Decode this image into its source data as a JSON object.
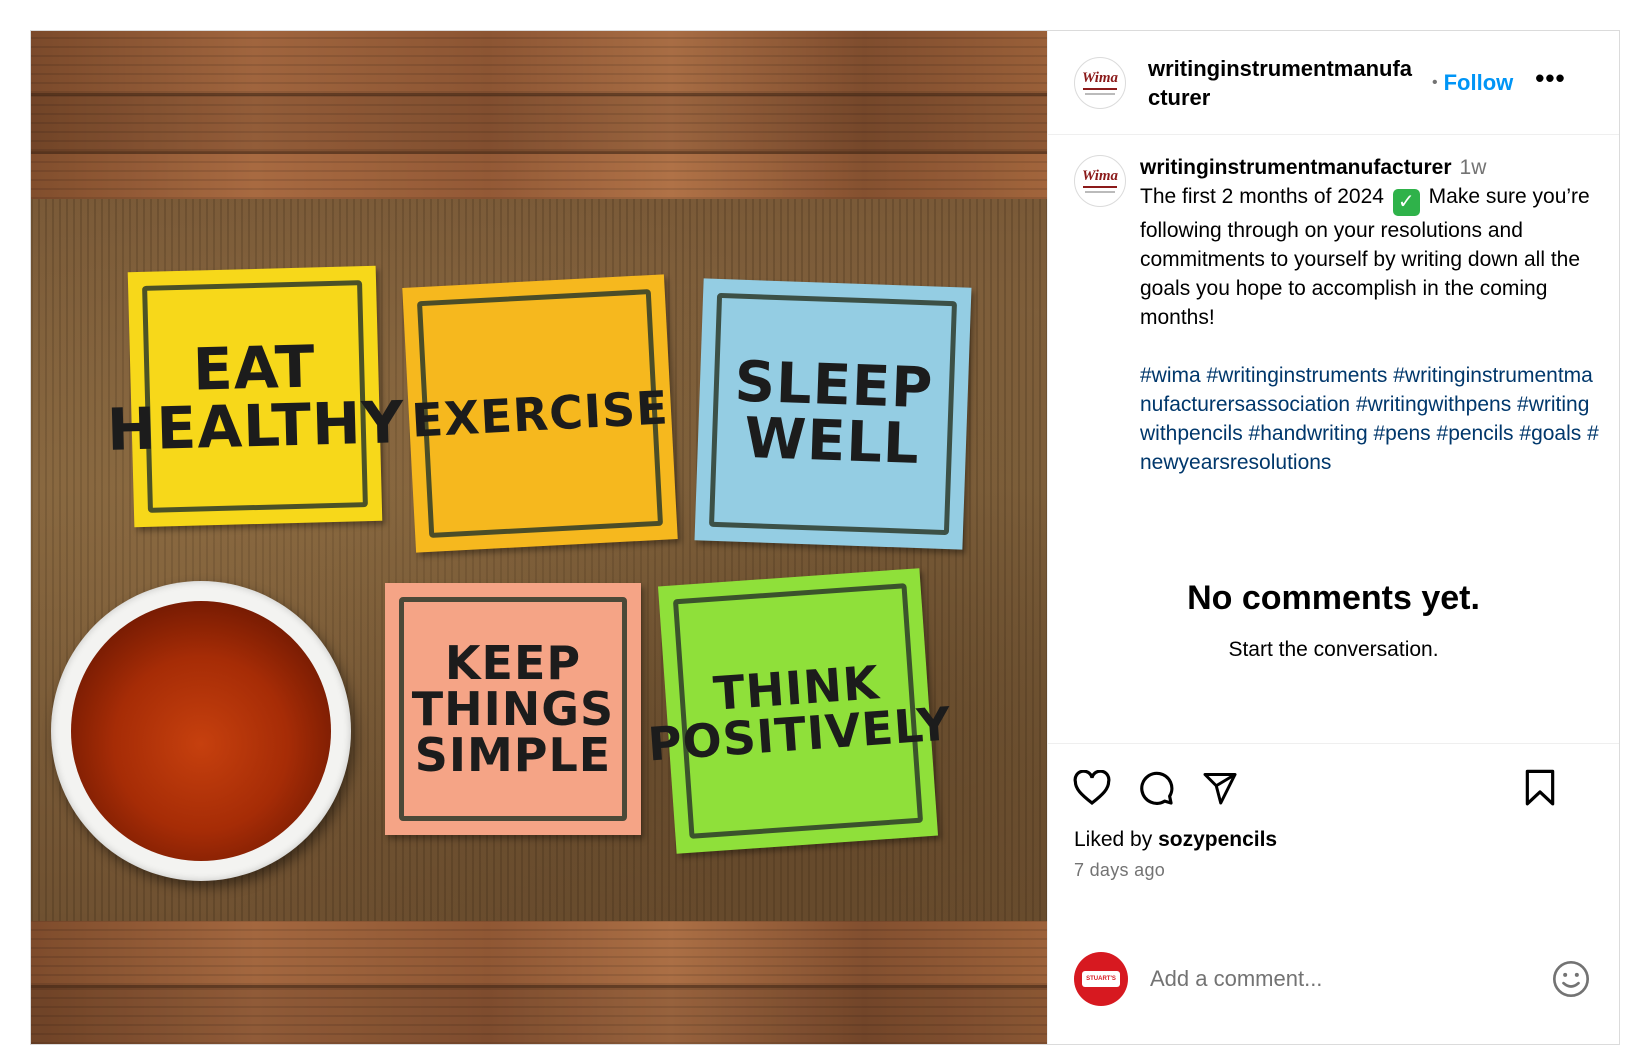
{
  "post": {
    "image_alt": "Sticky notes on wooden table with a cup of tea",
    "notes": [
      {
        "text": "EAT\nHEALTHY",
        "color": "#f7d81a"
      },
      {
        "text": "EXERCISE",
        "color": "#f6b81e"
      },
      {
        "text": "SLEEP\nWELL",
        "color": "#94cde3"
      },
      {
        "text": "KEEP\nTHINGS\nSIMPLE",
        "color": "#f5a486"
      },
      {
        "text": "THINK\nPOSITIVELY",
        "color": "#8fe03a"
      }
    ]
  },
  "header": {
    "username": "writinginstrumentmanufacturer",
    "separator": "•",
    "follow_label": "Follow",
    "more_label": "•••",
    "avatar_logo": "Wima"
  },
  "caption": {
    "username": "writinginstrumentmanufacturer",
    "time": "1w",
    "text_before_check": "The first 2 months of 2024",
    "check_glyph": "✓",
    "text_after_check": "Make sure you’re following through on your resolutions and commitments to yourself by writing down all the goals you hope to accomplish in the coming months!",
    "hashtags": "#wima #writinginstruments #writinginstrumentmanufacturersassociation #writingwithpens #writingwithpencils #handwriting #pens #pencils #goals #newyearsresolutions"
  },
  "comments": {
    "empty_title": "No comments yet.",
    "empty_subtitle": "Start the conversation."
  },
  "actions": {
    "liked_by_prefix": "Liked by",
    "liked_by_user": "sozypencils",
    "time_ago": "7 days ago",
    "icons": [
      "heart-icon",
      "comment-icon",
      "share-icon",
      "bookmark-icon"
    ]
  },
  "comment_bar": {
    "placeholder": "Add a comment...",
    "avatar_badge": "STUART'S"
  },
  "colors": {
    "link_blue": "#0095f6",
    "hashtag": "#00376b",
    "muted": "#737373",
    "border": "#dbdbdb"
  }
}
